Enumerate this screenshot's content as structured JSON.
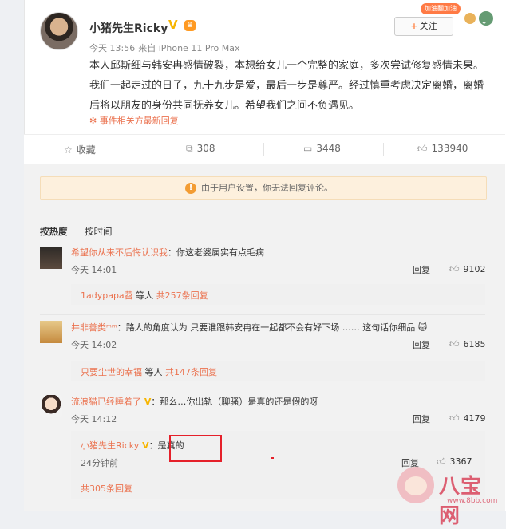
{
  "post": {
    "author": "小猪先生Ricky",
    "time": "今天 13:56",
    "device": "来自 iPhone 11 Pro Max",
    "text": "本人邱斯细与韩安冉感情破裂，本想给女儿一个完整的家庭，多次尝试修复感情未果。我们一起走过的日子，九十九步是爱，最后一步是尊严。经过慎重考虑决定离婚，离婚后将以朋友的身份共同抚养女儿。希望我们之间不负遇见。",
    "source": "事件相关方最新回复",
    "follow_label": "关注",
    "follow_plus": "+",
    "deco_tag": "加油翻加油"
  },
  "actions": {
    "favorite": "收藏",
    "repost": "308",
    "comments": "3448",
    "likes": "133940"
  },
  "notice": "由于用户设置，你无法回复评论。",
  "tabs": {
    "hot": "按热度",
    "time": "按时间"
  },
  "comments": [
    {
      "user": "希望你从来不后悔认识我",
      "text": "：你这老婆属实有点毛病",
      "time": "今天 14:01",
      "reply": "回复",
      "likes": "9102",
      "sub_user": "1adypapa苕",
      "sub_mid": " 等人 ",
      "sub_count": "共257条回复"
    },
    {
      "user": "井非善类ᵐᵐ",
      "text": "：路人的角度认为 只要谁跟韩安冉在一起都不会有好下场 …… 这句话你细品",
      "time": "今天 14:02",
      "reply": "回复",
      "likes": "6185",
      "sub_user": "只要尘世的幸福",
      "sub_mid": " 等人 ",
      "sub_count": "共147条回复"
    },
    {
      "user": "流浪猫已经睡着了",
      "text": "：那么…你出轨（聊骚）是真的还是假的呀",
      "time": "今天 14:12",
      "reply": "回复",
      "likes": "4179",
      "nested_user": "小猪先生Ricky",
      "nested_text": "：是真的",
      "nested_time": "24分钟前",
      "nested_reply": "回复",
      "nested_likes": "3367",
      "sub_count": "共305条回复"
    }
  ],
  "watermark": {
    "text": "八宝网",
    "url": "www.8bb.com"
  }
}
